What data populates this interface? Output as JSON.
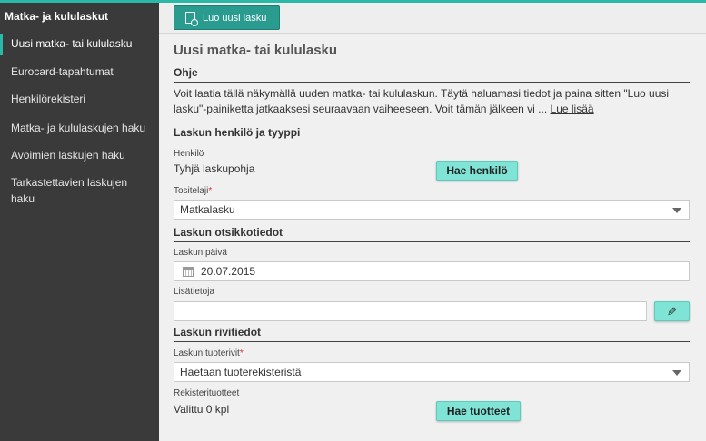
{
  "sidebar": {
    "title": "Matka- ja kululaskut",
    "items": [
      {
        "label": "Uusi matka- tai kululasku",
        "active": true
      },
      {
        "label": "Eurocard-tapahtumat"
      },
      {
        "label": "Henkilörekisteri"
      },
      {
        "label": "Matka- ja kululaskujen haku"
      },
      {
        "label": "Avoimien laskujen haku"
      },
      {
        "label": "Tarkastettavien laskujen haku"
      }
    ]
  },
  "toolbar": {
    "new_invoice_label": "Luo uusi lasku",
    "new_invoice_icon": "new-document-icon"
  },
  "page": {
    "title": "Uusi matka- tai kululasku"
  },
  "help": {
    "heading": "Ohje",
    "text": "Voit laatia tällä näkymällä uuden matka- tai kululaskun. Täytä haluamasi tiedot ja paina sitten \"Luo uusi lasku\"-painiketta jatkaaksesi seuraavaan vaiheeseen. Voit tämän jälkeen vi ...",
    "more_link": "Lue lisää"
  },
  "person_section": {
    "heading": "Laskun henkilö ja tyyppi",
    "person_label": "Henkilö",
    "person_value": "Tyhjä laskupohja",
    "find_person_button": "Hae henkilö",
    "voucher_type_label": "Tositelaji",
    "voucher_type_required": "*",
    "voucher_type_value": "Matkalasku"
  },
  "header_section": {
    "heading": "Laskun otsikkotiedot",
    "date_label": "Laskun päivä",
    "date_value": "20.07.2015",
    "date_icon": "calendar-icon",
    "extra_label": "Lisätietoja",
    "extra_value": "",
    "edit_icon": "pencil-icon"
  },
  "rows_section": {
    "heading": "Laskun rivitiedot",
    "product_rows_label": "Laskun tuoterivit",
    "product_rows_required": "*",
    "product_rows_value": "Haetaan tuoterekisteristä",
    "registry_label": "Rekisterituotteet",
    "registry_value": "Valittu 0 kpl",
    "find_products_button": "Hae tuotteet"
  },
  "colors": {
    "accent": "#2bb8a6",
    "button_dark": "#2a9b8f",
    "button_light": "#7fe3d6",
    "sidebar_bg": "#3a3a3a"
  }
}
